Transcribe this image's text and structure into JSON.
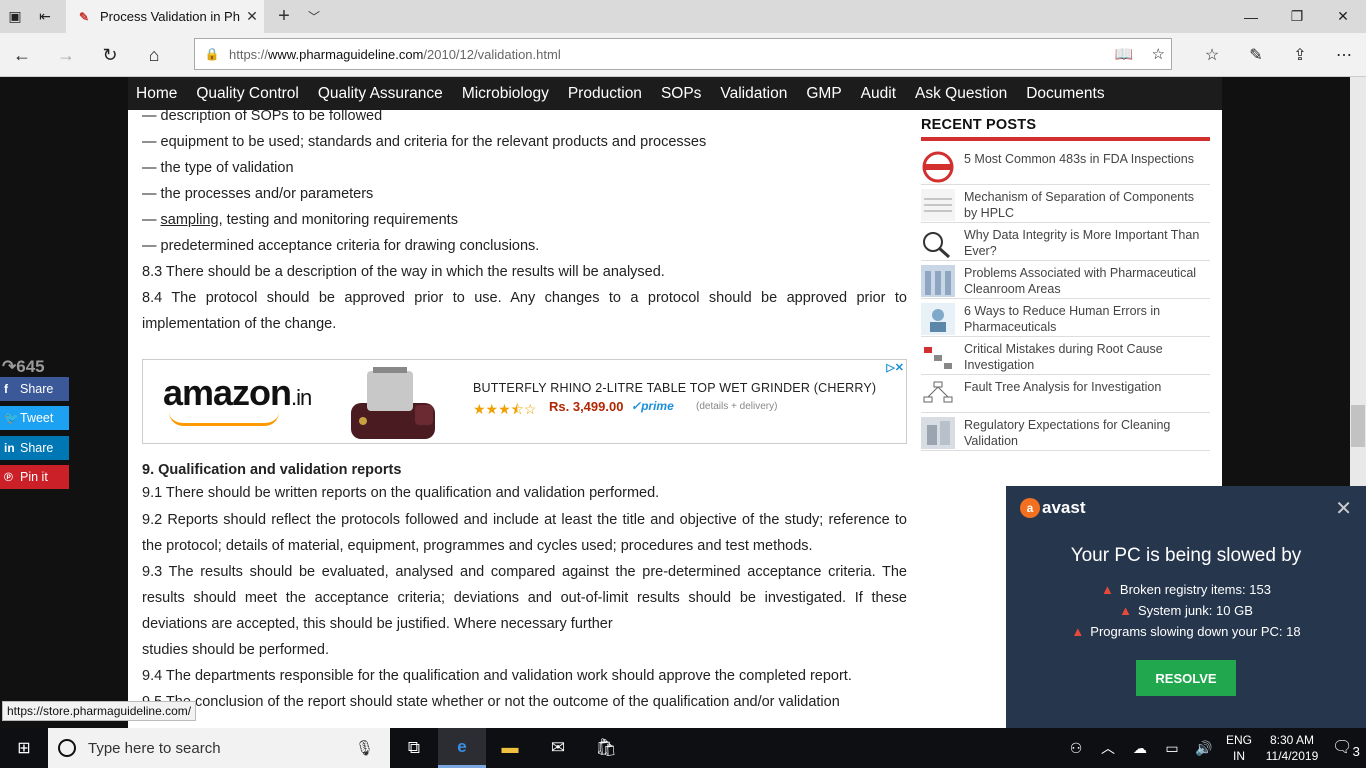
{
  "browser": {
    "tab_title": "Process Validation in Ph",
    "url_prefix": "https://",
    "url_host": "www.pharmaguideline.com",
    "url_path": "/2010/12/validation.html"
  },
  "site_menu": [
    "Home",
    "Quality Control",
    "Quality Assurance",
    "Microbiology",
    "Production",
    "SOPs",
    "Validation",
    "GMP",
    "Audit",
    "Ask Question",
    "Documents"
  ],
  "article": {
    "lines": [
      "— description of SOPs to be followed",
      "— equipment to be used; standards and criteria for the relevant products and processes",
      "— the type of validation",
      "— the processes and/or parameters"
    ],
    "sampling_prefix": "— ",
    "sampling_link": "sampling",
    "sampling_rest": ", testing and monitoring requirements",
    "line_criteria": "— predetermined acceptance criteria for drawing conclusions.",
    "p83": "8.3 There should be a description of the way in which the results will be analysed.",
    "p84": "8.4 The protocol should be approved prior to use. Any changes to a protocol should be approved prior to implementation of the change.",
    "section9_heading": "9. Qualification and validation reports",
    "p91": "9.1 There should be written reports on the qualification and validation performed.",
    "p92": "9.2 Reports should reflect the protocols followed and include at least the title and objective of the study; reference to the protocol; details of material, equipment, programmes and cycles used; procedures and test methods.",
    "p93": "9.3 The results should be evaluated, analysed and compared against the pre-determined acceptance criteria. The results should meet the acceptance criteria; deviations and out-of-limit results should be investigated. If these deviations are accepted, this should be justified. Where necessary further",
    "p93b": "studies should be performed.",
    "p94": "9.4 The departments responsible for the qualification and validation work should approve the completed report.",
    "p95": "9.5 The conclusion of the report should state whether or not the outcome of the qualification and/or validation"
  },
  "ad": {
    "brand": "amazon",
    "brand_suffix": ".in",
    "product": "BUTTERFLY RHINO 2-LITRE TABLE TOP WET GRINDER (CHERRY)",
    "rating": 3.5,
    "price": "Rs. 3,499.00",
    "prime": "prime",
    "details": "(details + delivery)"
  },
  "sidebar": {
    "heading": "RECENT POSTS",
    "posts": [
      "5 Most Common 483s in FDA Inspections",
      "Mechanism of Separation of Components by HPLC",
      "Why Data Integrity is More Important Than Ever?",
      "Problems Associated with Pharmaceutical Cleanroom Areas",
      "6 Ways to Reduce Human Errors in Pharmaceuticals",
      "Critical Mistakes during Root Cause Investigation",
      "Fault Tree Analysis for Investigation",
      "Regulatory Expectations for Cleaning Validation"
    ]
  },
  "share_bar": {
    "count": "645",
    "buttons": [
      {
        "label": "Share",
        "icon": "f",
        "color": "#3b5998"
      },
      {
        "label": "Tweet",
        "icon": "t",
        "color": "#1da1f2"
      },
      {
        "label": "Share",
        "icon": "in",
        "color": "#0077b5"
      },
      {
        "label": "Pin it",
        "icon": "p",
        "color": "#cb2027"
      }
    ]
  },
  "status_url": "https://store.pharmaguideline.com/",
  "avast": {
    "brand": "avast",
    "headline": "Your PC is being slowed by",
    "issues": [
      "Broken registry items: 153",
      "System junk: 10 GB",
      "Programs slowing down your PC: 18"
    ],
    "button": "RESOLVE"
  },
  "taskbar": {
    "search_placeholder": "Type here to search",
    "lang_top": "ENG",
    "lang_bottom": "IN",
    "time": "8:30 AM",
    "date": "11/4/2019",
    "notifications": "3"
  }
}
